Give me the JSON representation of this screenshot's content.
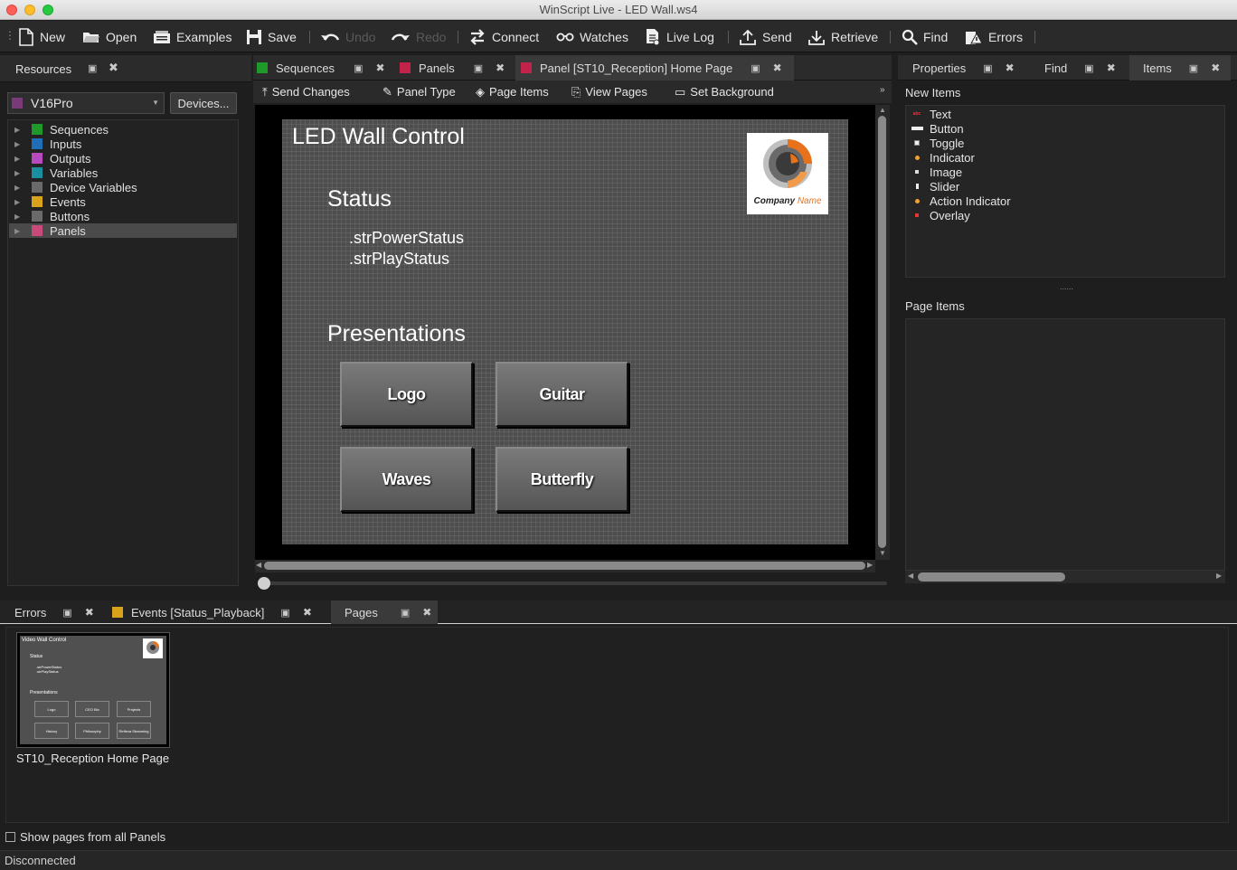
{
  "window": {
    "title": "WinScript Live - LED Wall.ws4"
  },
  "toolbar": {
    "new": "New",
    "open": "Open",
    "examples": "Examples",
    "save": "Save",
    "undo": "Undo",
    "redo": "Redo",
    "connect": "Connect",
    "watches": "Watches",
    "live_log": "Live Log",
    "send": "Send",
    "retrieve": "Retrieve",
    "find": "Find",
    "errors": "Errors"
  },
  "resources": {
    "title": "Resources",
    "device": "V16Pro",
    "devices_button": "Devices...",
    "items": [
      {
        "label": "Sequences",
        "color": "#1f9a2a"
      },
      {
        "label": "Inputs",
        "color": "#1f6fb8"
      },
      {
        "label": "Outputs",
        "color": "#b84ac0"
      },
      {
        "label": "Variables",
        "color": "#1a8fa0"
      },
      {
        "label": "Device Variables",
        "color": "#6a6a6a"
      },
      {
        "label": "Events",
        "color": "#d8a21a"
      },
      {
        "label": "Buttons",
        "color": "#6a6a6a"
      },
      {
        "label": "Panels",
        "color": "#c84a7a"
      }
    ],
    "selected": "Panels"
  },
  "center_tabs": {
    "sequences": "Sequences",
    "panels": "Panels",
    "panel_page": "Panel [ST10_Reception] Home Page"
  },
  "panel_toolbar": {
    "send_changes": "Send Changes",
    "panel_type": "Panel Type",
    "page_items": "Page Items",
    "view_pages": "View Pages",
    "set_background": "Set Background"
  },
  "panel_canvas": {
    "title": "LED Wall Control",
    "status_heading": "Status",
    "status_lines": [
      ".strPowerStatus",
      ".strPlayStatus"
    ],
    "presentations_heading": "Presentations",
    "buttons": [
      "Logo",
      "Guitar",
      "Waves",
      "Butterfly"
    ],
    "logo_text_a": "Company",
    "logo_text_b": "Name"
  },
  "right_tabs": {
    "properties": "Properties",
    "find": "Find",
    "items": "Items"
  },
  "new_items": {
    "title": "New Items",
    "items": [
      "Text",
      "Button",
      "Toggle",
      "Indicator",
      "Image",
      "Slider",
      "Action Indicator",
      "Overlay"
    ]
  },
  "page_items": {
    "title": "Page Items"
  },
  "bottom_tabs": {
    "errors": "Errors",
    "events": "Events [Status_Playback]",
    "pages": "Pages"
  },
  "pages": {
    "thumb_title": "Video Wall Control",
    "thumb_status": "Status",
    "thumb_lines": [
      ".strPowerStatus",
      ".strPlayStatus"
    ],
    "thumb_presentations": "Presentations",
    "thumb_buttons": [
      "Logo",
      "CEO Bio",
      "Projects",
      "History",
      "Philosophy",
      "Reflexa Streaming"
    ],
    "page_label": "ST10_Reception Home Page",
    "show_all_label": "Show pages from all Panels"
  },
  "status_bar": {
    "text": "Disconnected"
  },
  "colors": {
    "accent": "#3a3a3a",
    "canvas_bg": "#4d4d4d",
    "logo_orange": "#e8721c"
  }
}
